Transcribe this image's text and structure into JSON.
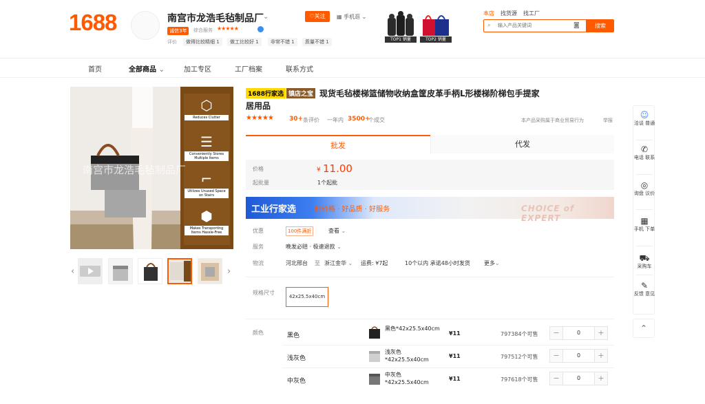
{
  "header": {
    "logo": "1688",
    "shop_name": "南宫市龙浩毛毡制品厂",
    "year_badge": "诚信3年",
    "service_label": "综合服务",
    "service_stars": "★★★★★",
    "review_label": "评价",
    "review_tags": [
      "做得比较精细 1",
      "做工比较好 1",
      "非常不错 1",
      "质量不错 1"
    ],
    "follow_label": "关注",
    "mobile_label": "手机逛",
    "top_badges": [
      "TOP1 销量",
      "TOP2 销量"
    ],
    "search_tabs": [
      "本店",
      "找货源",
      "找工厂"
    ],
    "search_placeholder": "输入产品关键词",
    "search_button": "搜索"
  },
  "nav": [
    "首页",
    "全部商品",
    "加工专区",
    "工厂档案",
    "联系方式"
  ],
  "gallery": {
    "watermark": "南宫市龙浩毛毡制品厂",
    "features": [
      "Reduces Clutter",
      "Conveniently Stores Multiple Items",
      "Utilizes Unused Space on Stairs",
      "Makes Transporting Items Hassle-Free"
    ]
  },
  "product": {
    "tag_select": "1688行家选",
    "tag_treasure": "镇店之宝",
    "title": "现货毛毡楼梯篮储物收纳盒筐皮革手柄L形楼梯阶梯包手提家居用品",
    "stars": "★★★★★",
    "review_count": "30+",
    "review_unit": "条评价",
    "year_label": "一年内",
    "sold": "3500+",
    "sold_unit": "个成交",
    "notice": "本产品采购属于商业贸易行为",
    "report": "举报"
  },
  "tabs": {
    "wholesale": "批发",
    "dropship": "代发"
  },
  "price": {
    "label": "价格",
    "currency": "¥",
    "value": "11.00",
    "moq_label": "起批量",
    "moq_value": "1个起批"
  },
  "banner": {
    "title": "工业行家选",
    "slogan": "好价格 · 好品质 · 好服务",
    "english": "CHOICE of EXPERT"
  },
  "promo": {
    "label": "优惠",
    "tag": "100件满折",
    "more": "查看"
  },
  "service": {
    "label": "服务",
    "value": "晚发必赔 · 极速退款"
  },
  "shipping": {
    "label": "物流",
    "from": "河北邢台",
    "to_word": "至",
    "to": "浙江金华",
    "fee": "运费: ¥7起",
    "promise": "10个以内 承诺48小时发货",
    "more": "更多"
  },
  "spec": {
    "label": "规格尺寸",
    "option": "42x25.5x40cm"
  },
  "color_label": "颜色",
  "skus": [
    {
      "color": "黑色",
      "desc": "黑色*42x25.5x40cm",
      "price": "¥11",
      "stock": "797384个可售",
      "qty": "0"
    },
    {
      "color": "浅灰色",
      "desc": "浅灰色*42x25.5x40cm",
      "price": "¥11",
      "stock": "797512个可售",
      "qty": "0"
    },
    {
      "color": "中灰色",
      "desc": "中灰色*42x25.5x40cm",
      "price": "¥11",
      "stock": "797618个可售",
      "qty": "0"
    }
  ],
  "rail": [
    {
      "icon": "chat-icon",
      "label": "洽谈 普通"
    },
    {
      "icon": "phone-icon",
      "label": "电话 联系"
    },
    {
      "icon": "target-icon",
      "label": "询盘 议价"
    },
    {
      "icon": "qrcode-icon",
      "label": "手机 下单"
    },
    {
      "icon": "cart-icon",
      "label": "采购车"
    },
    {
      "icon": "feedback-icon",
      "label": "反馈 意见"
    }
  ],
  "colors": {
    "accent": "#ff5a00",
    "price": "#ff3a00",
    "select_tag": "#ffd900"
  }
}
